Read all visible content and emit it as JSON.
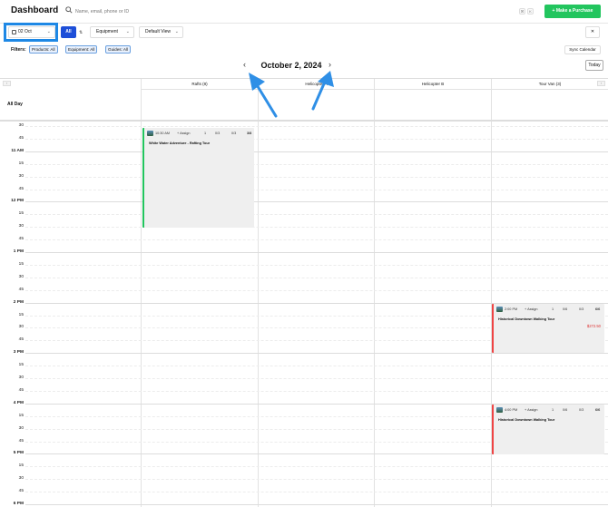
{
  "header": {
    "title": "Dashboard",
    "purchase_button": "+ Make a Purchase"
  },
  "search": {
    "placeholder": "Name, email, phone or ID",
    "kbd_1": "⌘",
    "kbd_2": "K"
  },
  "toolbar": {
    "date_value": "02 Oct",
    "all_button": "All",
    "equipment_select": "Equipment",
    "view_select": "Default View",
    "close_label": "✕"
  },
  "filters": {
    "label": "Filters:",
    "products": "Products: All",
    "equipment": "Equipment: All",
    "guides": "Guides: All",
    "sync_button": "Sync Calendar"
  },
  "datebar": {
    "date_title": "October 2, 2024",
    "today_button": "Today",
    "prev": "‹",
    "next": "›"
  },
  "columns": [
    {
      "label": "Rafts (8)"
    },
    {
      "label": "Helicopter A"
    },
    {
      "label": "Helicopter B"
    },
    {
      "label": "Tour Van (3)"
    }
  ],
  "allday_label": "All Day",
  "time_labels": [
    "30",
    "45",
    "11 AM",
    "15",
    "30",
    "45",
    "12 PM",
    "15",
    "30",
    "45",
    "1 PM",
    "15",
    "30",
    "45",
    "2 PM",
    "15",
    "30",
    "45",
    "3 PM",
    "15",
    "30",
    "45",
    "4 PM",
    "15",
    "30",
    "45",
    "5 PM",
    "15",
    "30",
    "45",
    "6 PM"
  ],
  "events": [
    {
      "time": "10:30 AM",
      "assign": "+ Assign",
      "count": "1",
      "checked": "0/3",
      "equip": "0/3",
      "capacity": "3/8",
      "title": "White Water Adventure - Rafting Tour",
      "price": "",
      "accent": "#22c55e"
    },
    {
      "time": "2:00 PM",
      "assign": "+ Assign",
      "count": "1",
      "checked": "0/6",
      "equip": "0/3",
      "capacity": "6/6",
      "title": "Historical Downtown Walking Tour",
      "price": "$272.50",
      "accent": "#ef4444"
    },
    {
      "time": "4:00 PM",
      "assign": "+ Assign",
      "count": "1",
      "checked": "0/6",
      "equip": "0/3",
      "capacity": "6/6",
      "title": "Historical Downtown Walking Tour",
      "price": "",
      "accent": "#ef4444"
    }
  ],
  "colors": {
    "accent_blue": "#1d4ed8",
    "highlight": "#1e88e5",
    "brand_green": "#22c55e"
  }
}
